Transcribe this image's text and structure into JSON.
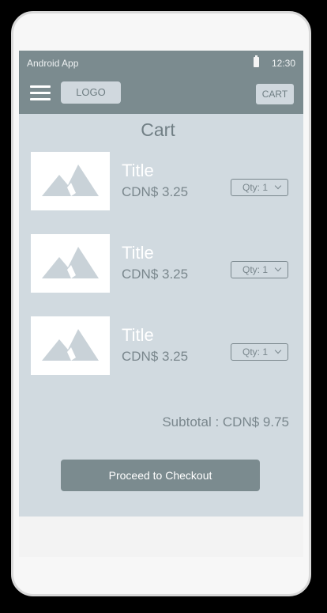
{
  "status_bar": {
    "app_name": "Android App",
    "time": "12:30",
    "battery_icon": "battery-icon"
  },
  "app_bar": {
    "menu_icon": "hamburger-menu-icon",
    "logo_text": "LOGO",
    "cart_label": "CART"
  },
  "page": {
    "title": "Cart"
  },
  "items": [
    {
      "title": "Title",
      "price": "CDN$ 3.25",
      "qty": "Qty: 1",
      "image_icon": "image-placeholder-icon"
    },
    {
      "title": "Title",
      "price": "CDN$ 3.25",
      "qty": "Qty: 1",
      "image_icon": "image-placeholder-icon"
    },
    {
      "title": "Title",
      "price": "CDN$ 3.25",
      "qty": "Qty: 1",
      "image_icon": "image-placeholder-icon"
    }
  ],
  "summary": {
    "subtotal": "Subtotal : CDN$ 9.75"
  },
  "actions": {
    "checkout_label": "Proceed to Checkout"
  },
  "colors": {
    "app_bar": "#7b8b8f",
    "content_bg": "#d1dae0",
    "accent_text": "#7a878d"
  }
}
